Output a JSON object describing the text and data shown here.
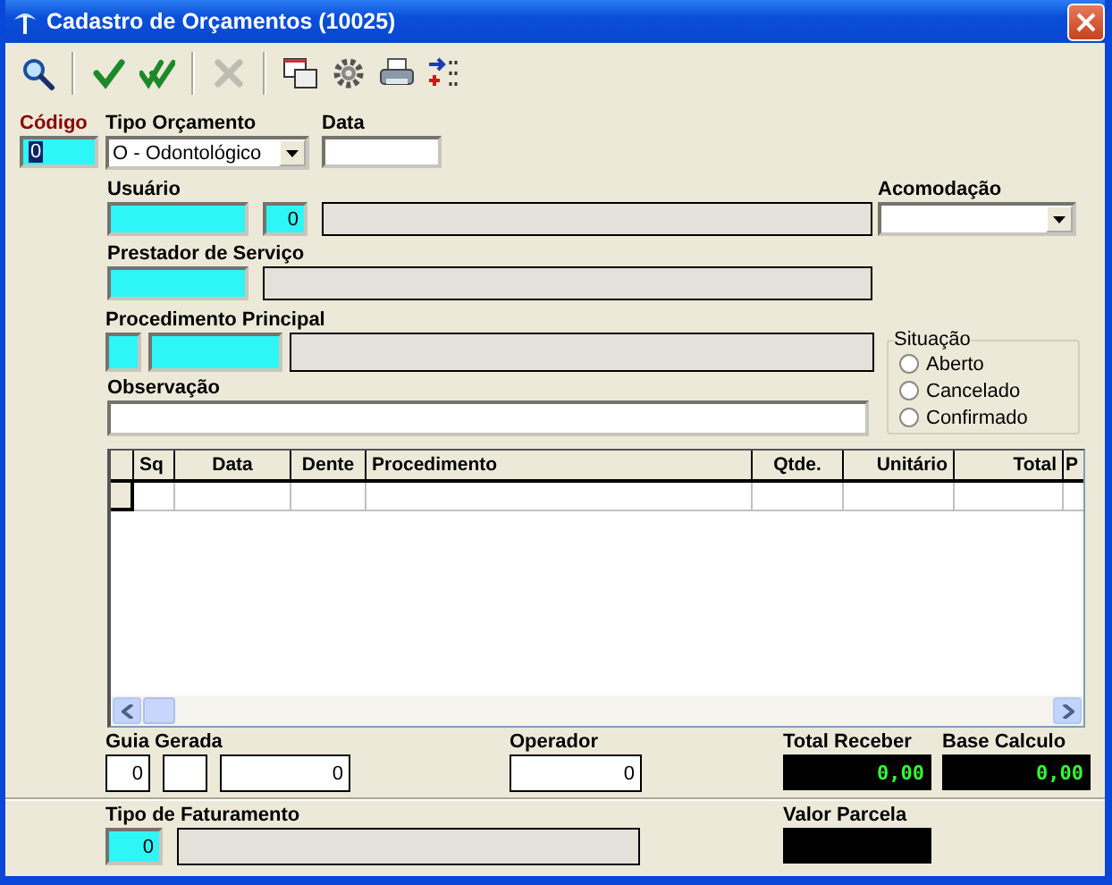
{
  "window": {
    "title": "Cadastro de Orçamentos (10025)"
  },
  "toolbar": [
    {
      "kind": "search",
      "disabled": false
    },
    {
      "kind": "confirm",
      "disabled": false
    },
    {
      "kind": "confirm_all",
      "disabled": false
    },
    {
      "kind": "cancel",
      "disabled": true
    },
    {
      "kind": "windows",
      "disabled": false
    },
    {
      "kind": "settings",
      "disabled": false
    },
    {
      "kind": "print",
      "disabled": false
    },
    {
      "kind": "transfer",
      "disabled": false
    }
  ],
  "codigo": {
    "label": "Código",
    "value": "0"
  },
  "tipo_orcamento": {
    "label": "Tipo Orçamento",
    "value": "O - Odontológico"
  },
  "data": {
    "label": "Data"
  },
  "usuario": {
    "label": "Usuário",
    "code": "0"
  },
  "acomodacao": {
    "label": "Acomodação"
  },
  "prestador": {
    "label": "Prestador de Serviço"
  },
  "procedimento_principal": {
    "label": "Procedimento Principal"
  },
  "observacao": {
    "label": "Observação"
  },
  "situacao": {
    "title": "Situação",
    "options": [
      {
        "label": "Aberto",
        "selected": false
      },
      {
        "label": "Cancelado",
        "selected": false
      },
      {
        "label": "Confirmado",
        "selected": false
      }
    ]
  },
  "table": {
    "columns": [
      "Sq",
      "Data",
      "Dente",
      "Procedimento",
      "Qtde.",
      "Unitário",
      "Total",
      "P"
    ]
  },
  "guia_gerada": {
    "label": "Guia Gerada",
    "field_1": "0",
    "field_3": "0"
  },
  "operador": {
    "label": "Operador",
    "value": "0"
  },
  "total_receber": {
    "label": "Total Receber",
    "value": "0,00"
  },
  "base_calculo": {
    "label": "Base Calculo",
    "value": "0,00"
  },
  "tipo_faturamento": {
    "label": "Tipo de Faturamento",
    "value": "0"
  },
  "valor_parcela": {
    "label": "Valor Parcela"
  }
}
